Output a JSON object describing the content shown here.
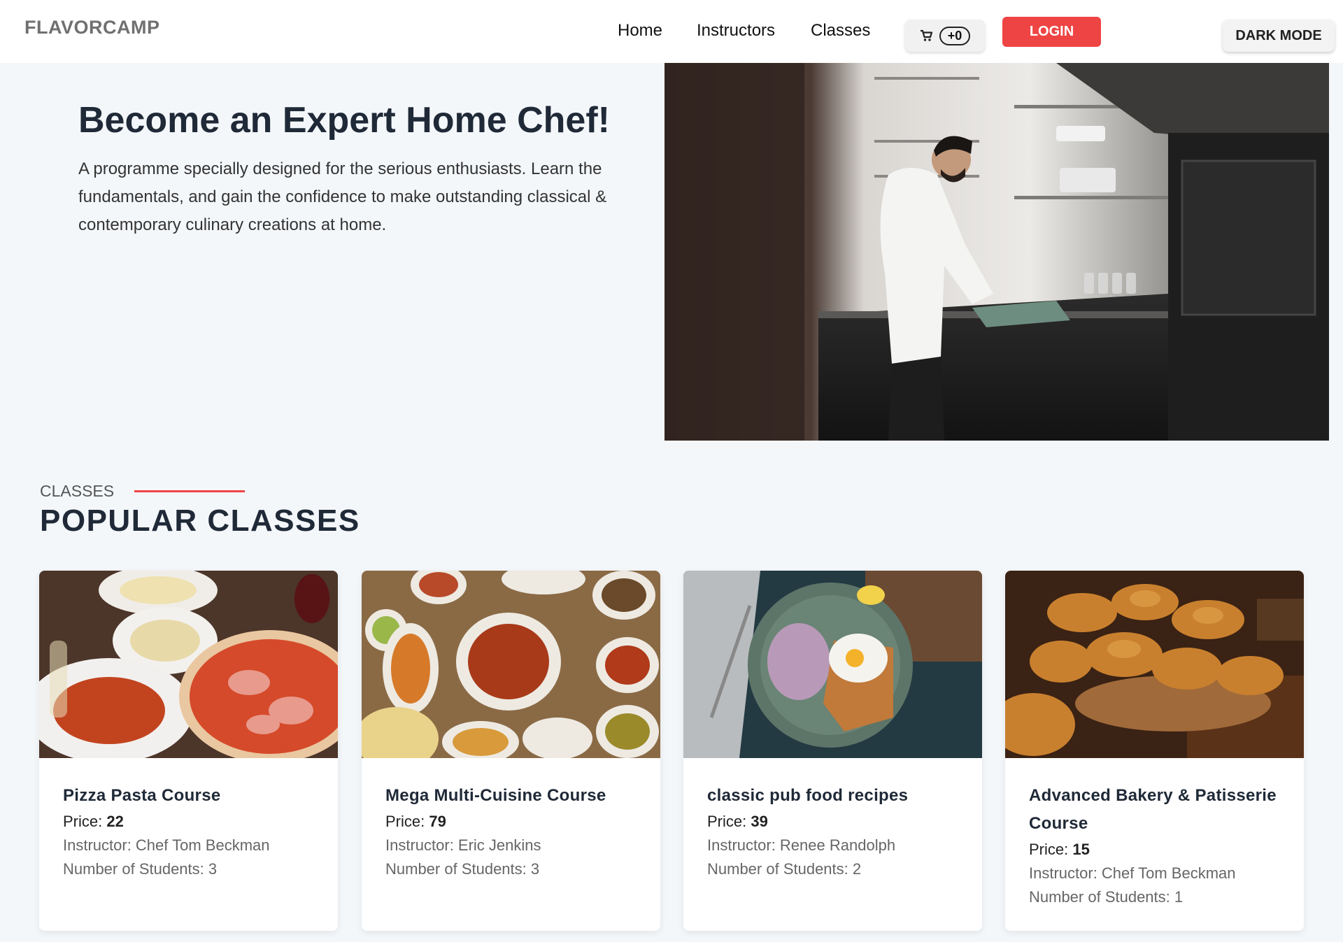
{
  "navbar": {
    "brand": "FLAVORCAMP",
    "links": [
      "Home",
      "Instructors",
      "Classes"
    ],
    "cart_count": "+0",
    "login_label": "LOGIN",
    "dark_mode_label": "DARK MODE"
  },
  "hero": {
    "title": "Become an Expert Home Chef!",
    "description": "A programme specially designed for the serious enthusiasts. Learn the fundamentals, and gain the confidence to make outstanding classical & contemporary culinary creations at home."
  },
  "section": {
    "label": "CLASSES",
    "title": "POPULAR CLASSES"
  },
  "classes": [
    {
      "title": "Pizza Pasta Course",
      "price_label": "Price:",
      "price": "22",
      "instructor": "Instructor: Chef Tom Beckman",
      "students": "Number of Students: 3"
    },
    {
      "title": "Mega Multi-Cuisine Course",
      "price_label": "Price:",
      "price": "79",
      "instructor": "Instructor: Eric Jenkins",
      "students": "Number of Students: 3"
    },
    {
      "title": "classic pub food recipes",
      "price_label": "Price:",
      "price": "39",
      "instructor": "Instructor: Renee Randolph",
      "students": "Number of Students: 2"
    },
    {
      "title": "Advanced Bakery & Patisserie Course",
      "price_label": "Price:",
      "price": "15",
      "instructor": "Instructor: Chef Tom Beckman",
      "students": "Number of Students: 1"
    }
  ],
  "colors": {
    "accent": "#ef4444",
    "background": "#f4f7fa",
    "heading": "#1f2937"
  },
  "icons": {
    "cart": "cart-icon"
  }
}
